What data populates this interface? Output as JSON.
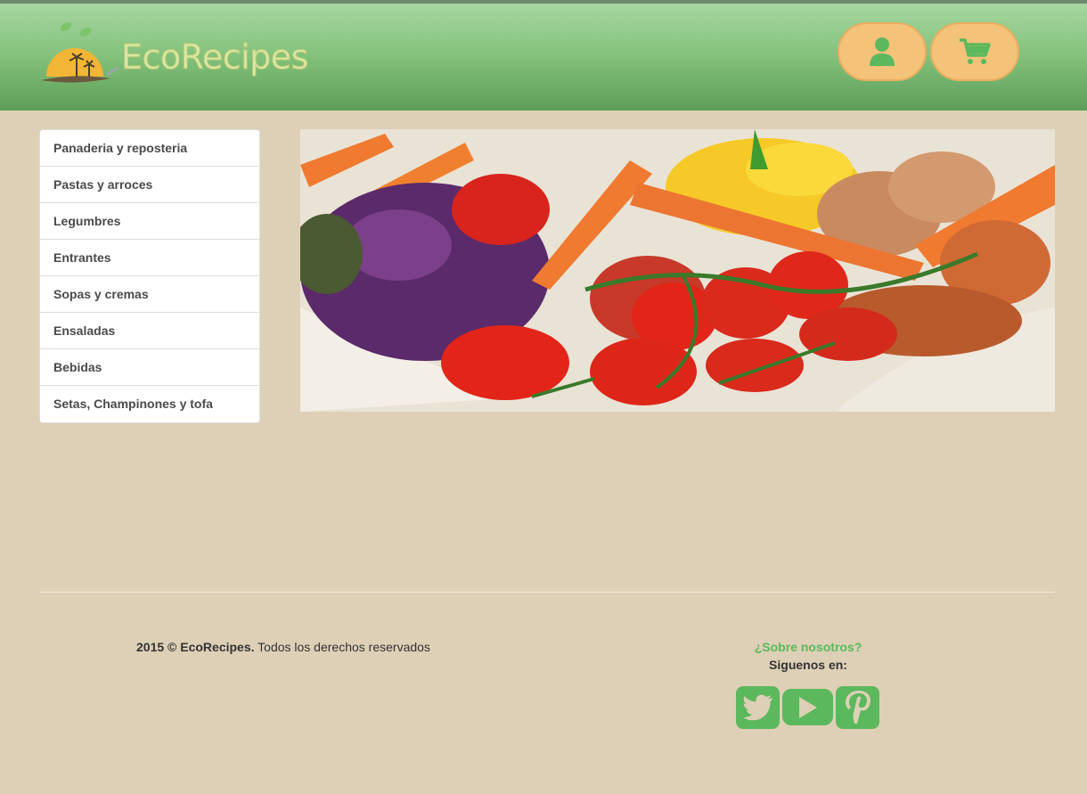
{
  "header": {
    "brand": "EcoRecipes",
    "user_icon": "user-icon",
    "cart_icon": "cart-icon"
  },
  "menu": {
    "items": [
      {
        "label": "Panaderia y reposteria"
      },
      {
        "label": "Pastas y arroces"
      },
      {
        "label": "Legumbres"
      },
      {
        "label": "Entrantes"
      },
      {
        "label": "Sopas y cremas"
      },
      {
        "label": "Ensaladas"
      },
      {
        "label": "Bebidas"
      },
      {
        "label": "Setas, Champinones y tofa"
      }
    ]
  },
  "footer": {
    "year": "2015 ©",
    "brand": "EcoRecipes.",
    "rights": " Todos los derechos reservados",
    "about_link": "¿Sobre nosotros?",
    "follow_label": "Siguenos en:",
    "social": [
      "twitter-icon",
      "youtube-icon",
      "pinterest-icon"
    ]
  },
  "colors": {
    "background": "#ddd0b6",
    "accent_green": "#5cb85c",
    "button_orange": "#f5c27a"
  }
}
